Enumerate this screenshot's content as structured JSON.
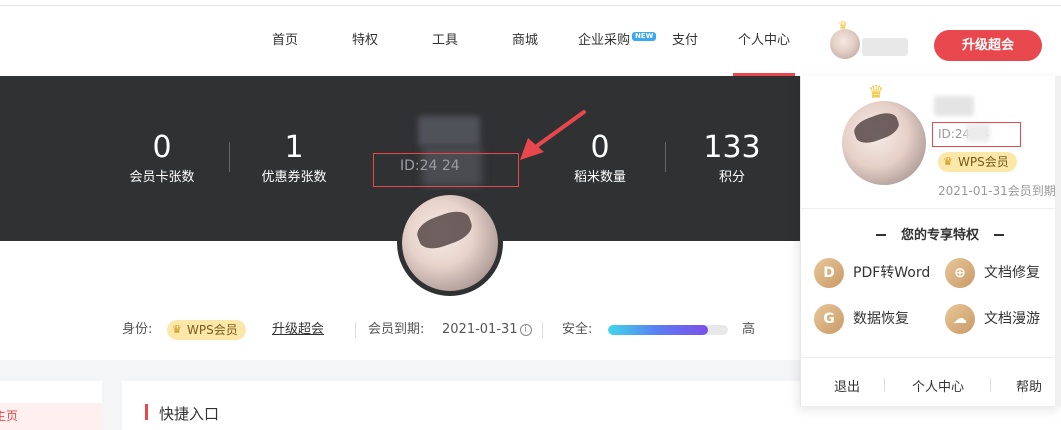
{
  "nav": {
    "items": [
      "首页",
      "特权",
      "工具",
      "商城",
      "企业采购",
      "支付",
      "个人中心"
    ],
    "new_badge": "NEW",
    "upgrade_label": "升级超会"
  },
  "stats": [
    {
      "value": "0",
      "label": "会员卡张数"
    },
    {
      "value": "1",
      "label": "优惠券张数"
    },
    {
      "value": "0",
      "label": "稻米数量"
    },
    {
      "value": "133",
      "label": "积分"
    }
  ],
  "banner": {
    "id_text": "ID:24        24"
  },
  "identity": {
    "identity_label": "身份:",
    "wps_badge": "WPS会员",
    "upgrade_link": "升级超会",
    "expire_label": "会员到期:",
    "expire_date": "2021-01-31",
    "info_icon": "i",
    "security_label": "安全:",
    "security_level": "高",
    "security_fraction": 0.83
  },
  "sidebar": {
    "item": "主页"
  },
  "quick": {
    "title": "快捷入口"
  },
  "panel": {
    "id_text": "ID:24        24",
    "wps_badge": "WPS会员",
    "expire_text": "2021-01-31会员到期",
    "privileges_title": "您的专享特权",
    "features": [
      {
        "icon": "pdf-icon",
        "glyph": "D",
        "label": "PDF转Word"
      },
      {
        "icon": "repair-icon",
        "glyph": "⊕",
        "label": "文档修复"
      },
      {
        "icon": "recover-icon",
        "glyph": "G",
        "label": "数据恢复"
      },
      {
        "icon": "cloud-icon",
        "glyph": "☁",
        "label": "文档漫游"
      }
    ],
    "footer": [
      "退出",
      "个人中心",
      "帮助"
    ]
  },
  "colors": {
    "accent": "#e8484d",
    "banner_bg": "#303133",
    "badge_gold": "#fbe7a8",
    "new_badge": "#3aa8f0"
  }
}
